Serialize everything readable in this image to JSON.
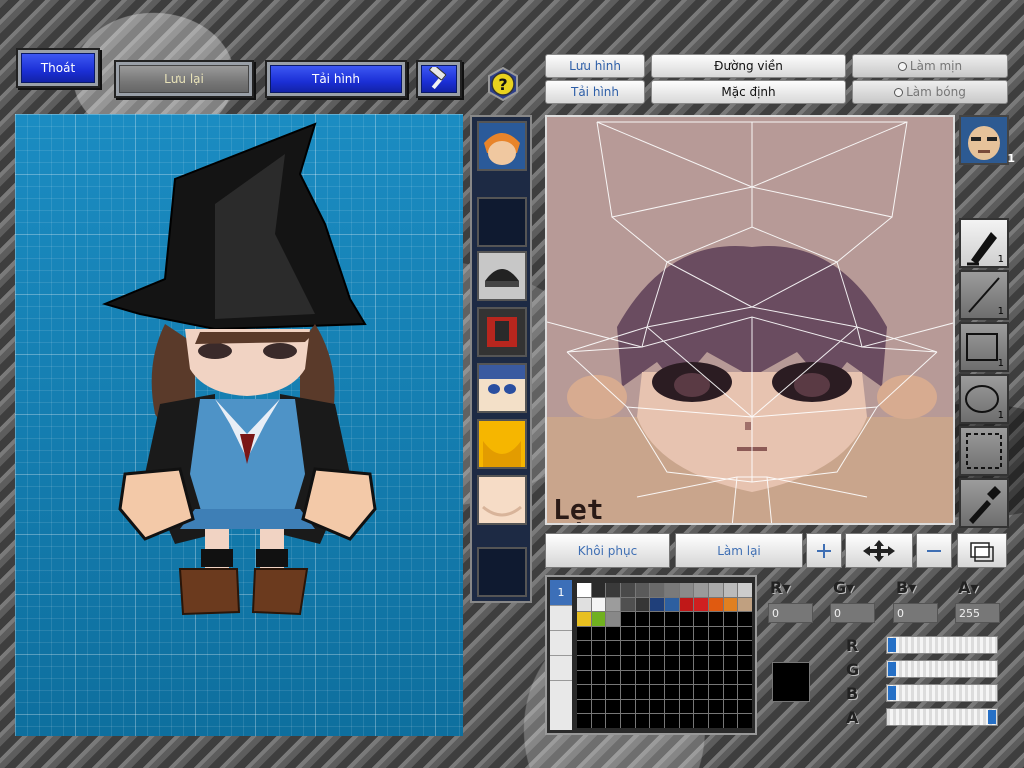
{
  "top_left": {
    "exit_label": "Thoát",
    "save_label": "Lưu lại",
    "load_label": "Tải hình"
  },
  "right_tabs": {
    "save_label": "Lưu hình",
    "load_label": "Tải hình",
    "outline_label": "Đường viền",
    "default_label": "Mặc định",
    "smooth_label": "Làm mịn",
    "shade_label": "Làm bóng"
  },
  "texture_editor": {
    "overlay_text": "Lẹt"
  },
  "tools": [
    {
      "name": "pen",
      "count": "1"
    },
    {
      "name": "line",
      "count": "1"
    },
    {
      "name": "rectangle",
      "count": "1"
    },
    {
      "name": "ellipse",
      "count": "1"
    },
    {
      "name": "select",
      "count": ""
    },
    {
      "name": "eyedropper",
      "count": ""
    }
  ],
  "actions": {
    "restore_label": "Khôi phục",
    "redo_label": "Làm lại"
  },
  "palette": {
    "tab_label": "1",
    "colors": [
      "#ffffff",
      "#2a2a2a",
      "#3a3a3a",
      "#4a4a4a",
      "#5a5a5a",
      "#6a6a6a",
      "#7a7a7a",
      "#8a8a8a",
      "#9a9a9a",
      "#aaaaaa",
      "#bbbbbb",
      "#cccccc",
      "#e0e0e0",
      "#f4f4f4",
      "#9c9c9c",
      "#505050",
      "#363636",
      "#1f3f7a",
      "#2d5fa0",
      "#c01818",
      "#d02020",
      "#e05a10",
      "#e08020",
      "#c0a080",
      "#e8c020",
      "#70b020",
      "#888888"
    ]
  },
  "color": {
    "r": "0",
    "g": "0",
    "b": "0",
    "a": "255",
    "current": "#000000",
    "r_level": 0,
    "g_level": 0,
    "b_level": 0,
    "a_level": 1
  }
}
